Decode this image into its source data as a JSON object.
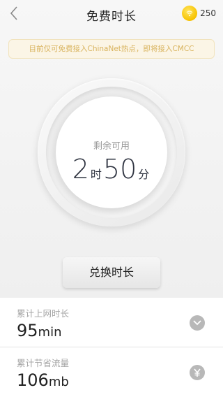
{
  "nav": {
    "title": "免费时长",
    "coins": "250",
    "icons": {
      "back": "chevron-left-icon",
      "coin": "coin-icon"
    }
  },
  "notice": "目前仅可免费接入ChinaNet热点，即将接入CMCC",
  "dial": {
    "label": "剩余可用",
    "hours": "2",
    "hours_unit": "时",
    "minutes": "50",
    "minutes_unit": "分"
  },
  "redeem_button": "兑换时长",
  "stats": [
    {
      "label": "累计上网时长",
      "value": "95",
      "unit": "min",
      "icon": "clock-chevron-icon"
    },
    {
      "label": "累计节省流量",
      "value": "106",
      "unit": "mb",
      "icon": "yen-icon"
    }
  ],
  "colors": {
    "coin": "#f7c200",
    "notice_text": "#d9b45f",
    "notice_bg": "#fbf5e6",
    "dial_text": "#2e3340"
  }
}
